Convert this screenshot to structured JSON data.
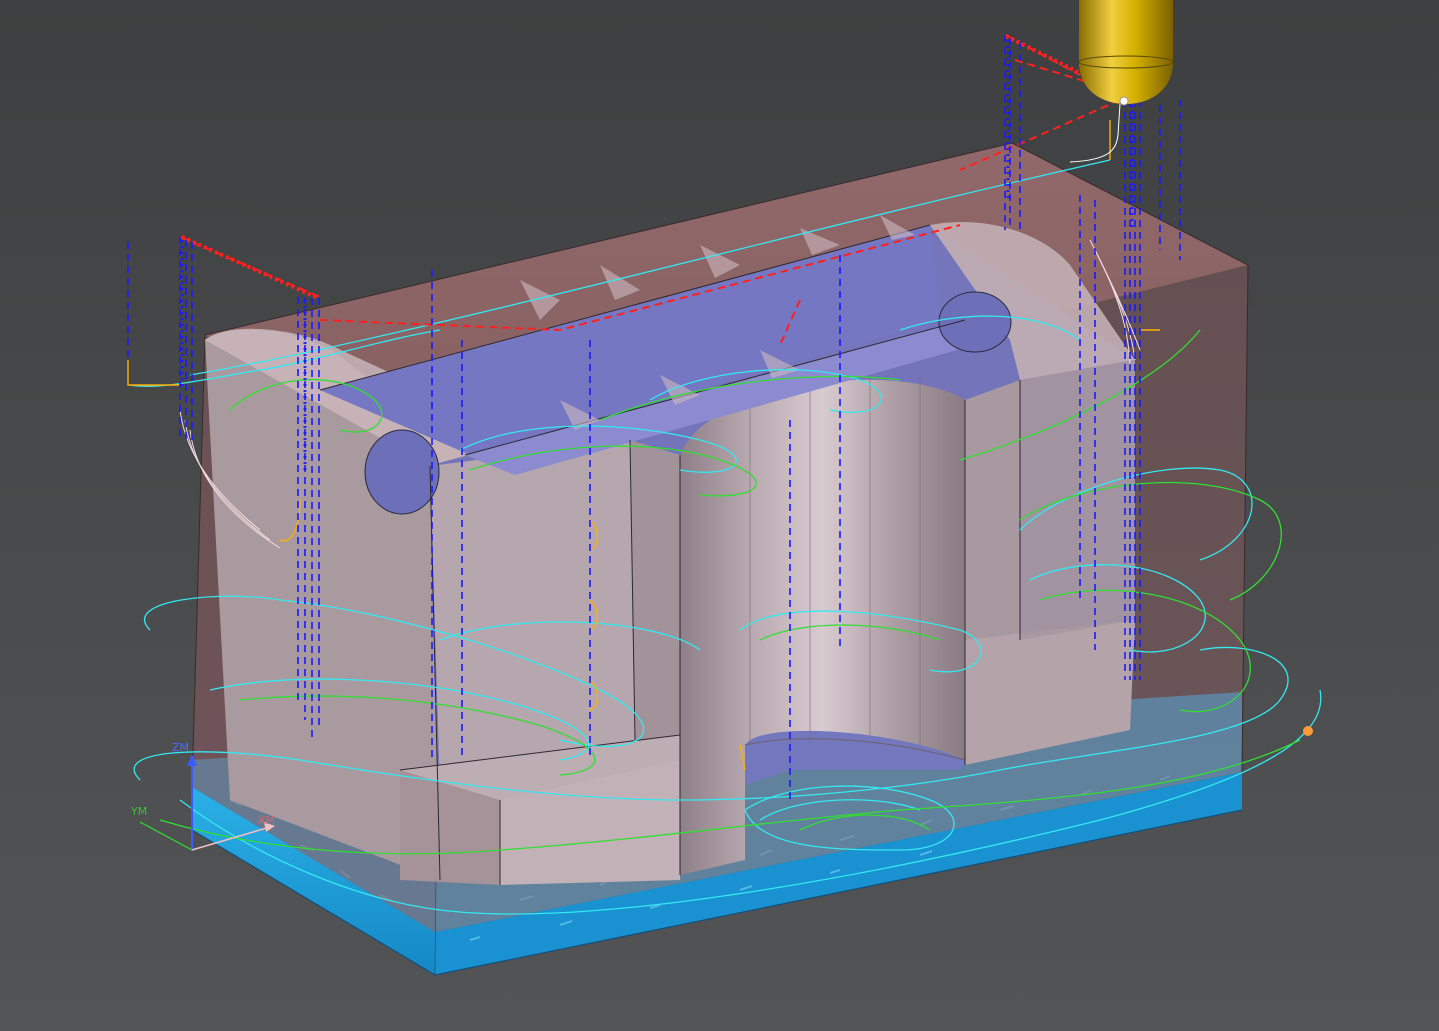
{
  "viewport": {
    "background_top": "#3e3f40",
    "background_bottom": "#525456"
  },
  "axes": {
    "z_label": "ZM",
    "y_label": "YM",
    "x_label": "XM",
    "z_color": "#3a5cff",
    "y_color": "#38c43a",
    "x_color": "#e06060"
  },
  "colors": {
    "stock_face": "#a06a6a",
    "part_face": "#b8a8ac",
    "floor_blue": "#7a7cc8",
    "base_cyan": "#1e9fd8",
    "toolpath_cyan": "#35e8f0",
    "toolpath_green": "#33dd33",
    "rapid_red": "#ff2020",
    "plunge_blue": "#1a1aff",
    "engage_yellow": "#ffb000",
    "retract_white": "#f4dde0",
    "tool_gold": "#d4b000"
  },
  "scene": {
    "icons": [
      "ball-end-mill-tool-icon",
      "wcs-triad-icon"
    ]
  }
}
